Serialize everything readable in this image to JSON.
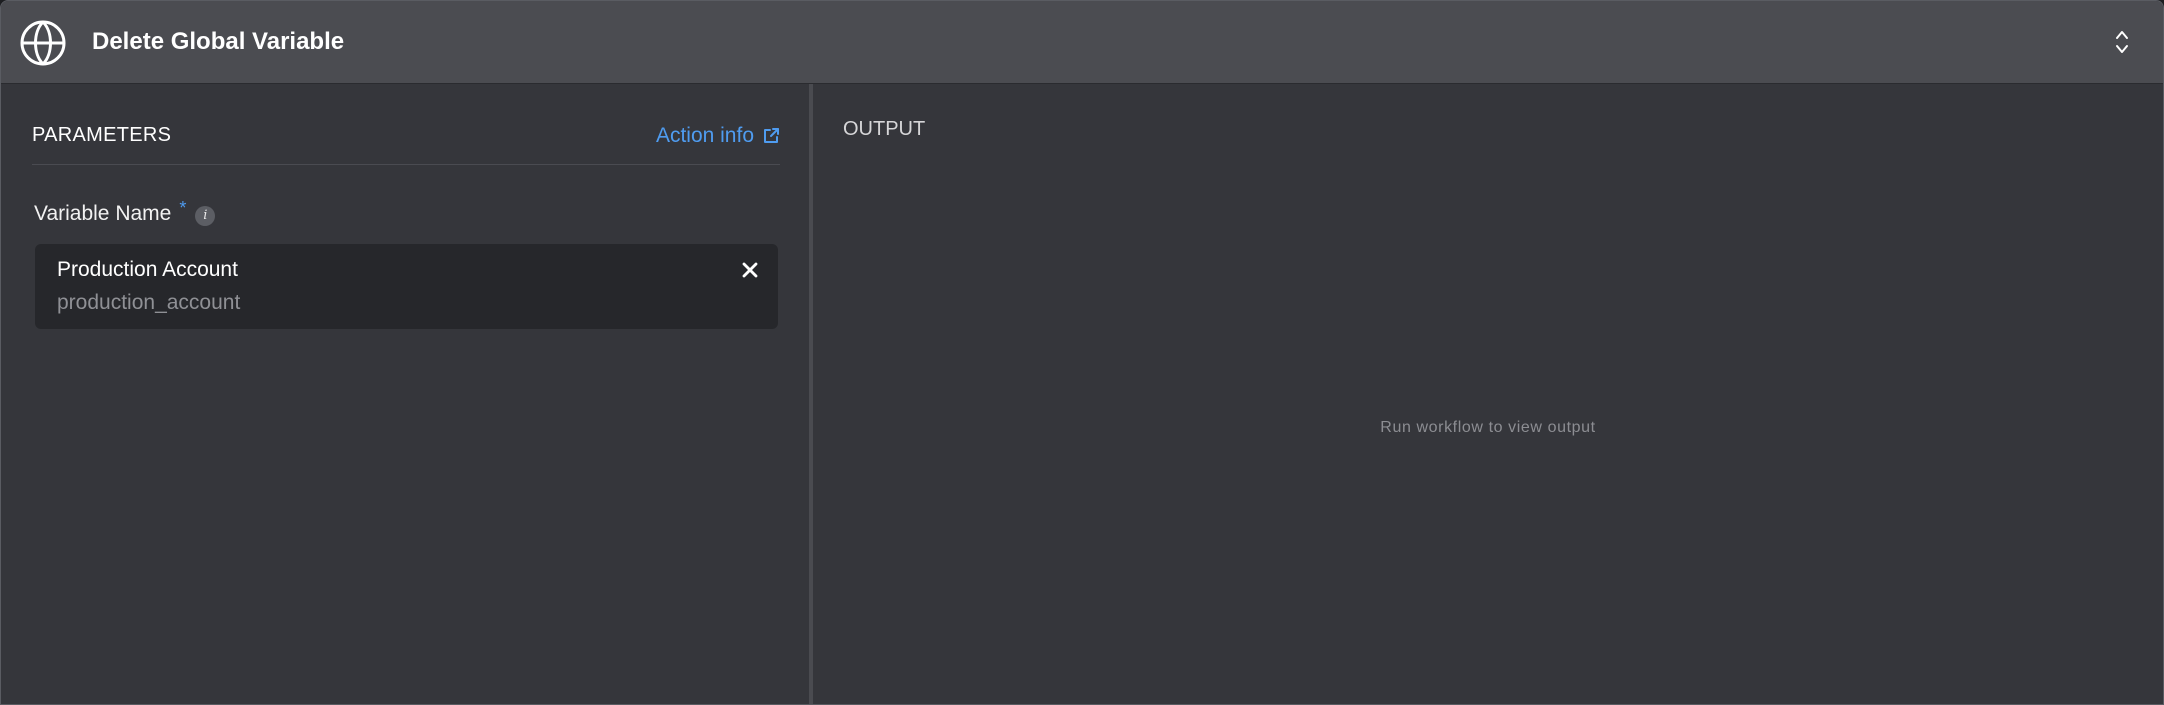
{
  "header": {
    "title": "Delete Global Variable",
    "icon": "globe-icon",
    "collapse_icon": "expand-collapse-icon"
  },
  "parameters": {
    "title": "PARAMETERS",
    "action_info_label": "Action info",
    "action_info_icon": "external-link-icon",
    "accent_color": "#4f9cf0",
    "field": {
      "label": "Variable Name",
      "required_marker": "*",
      "info_icon_glyph": "i",
      "selected_value": {
        "name": "Production Account",
        "key": "production_account"
      }
    }
  },
  "output": {
    "title": "OUTPUT",
    "empty_message": "Run workflow to view output"
  }
}
